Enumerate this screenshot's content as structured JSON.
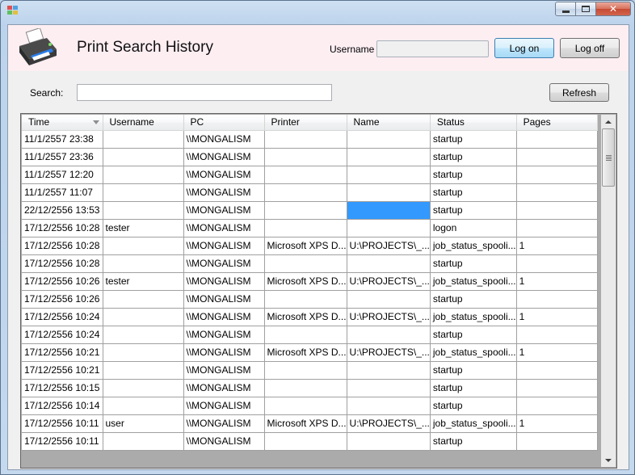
{
  "window": {
    "close_glyph": "✕",
    "minimize_icon": "minimize-icon",
    "maximize_icon": "maximize-icon"
  },
  "header": {
    "title": "Print Search History",
    "username_label": "Username",
    "username_value": "",
    "logon_label": "Log on",
    "logoff_label": "Log off"
  },
  "search": {
    "label": "Search:",
    "value": "",
    "refresh_label": "Refresh"
  },
  "colors": {
    "header_band": "#fdeef2",
    "selection": "#3399ff",
    "printer_body": "#3a3a3a",
    "printer_paper": "#2b7de9"
  },
  "grid": {
    "columns": [
      "Time",
      "Username",
      "PC",
      "Printer",
      "Name",
      "Status",
      "Pages"
    ],
    "sorted_column": "Time",
    "selected_cell": {
      "row": 4,
      "column": "Name"
    },
    "rows": [
      [
        "11/1/2557 23:38",
        "",
        "\\\\MONGALISM",
        "",
        "",
        "startup",
        ""
      ],
      [
        "11/1/2557 23:36",
        "",
        "\\\\MONGALISM",
        "",
        "",
        "startup",
        ""
      ],
      [
        "11/1/2557 12:20",
        "",
        "\\\\MONGALISM",
        "",
        "",
        "startup",
        ""
      ],
      [
        "11/1/2557 11:07",
        "",
        "\\\\MONGALISM",
        "",
        "",
        "startup",
        ""
      ],
      [
        "22/12/2556 13:53",
        "",
        "\\\\MONGALISM",
        "",
        "",
        "startup",
        ""
      ],
      [
        "17/12/2556 10:28",
        "tester",
        "\\\\MONGALISM",
        "",
        "",
        "logon",
        ""
      ],
      [
        "17/12/2556 10:28",
        "",
        "\\\\MONGALISM",
        "Microsoft XPS D...",
        "U:\\PROJECTS\\_...",
        "job_status_spooli...",
        "1"
      ],
      [
        "17/12/2556 10:28",
        "",
        "\\\\MONGALISM",
        "",
        "",
        "startup",
        ""
      ],
      [
        "17/12/2556 10:26",
        "tester",
        "\\\\MONGALISM",
        "Microsoft XPS D...",
        "U:\\PROJECTS\\_...",
        "job_status_spooli...",
        "1"
      ],
      [
        "17/12/2556 10:26",
        "",
        "\\\\MONGALISM",
        "",
        "",
        "startup",
        ""
      ],
      [
        "17/12/2556 10:24",
        "",
        "\\\\MONGALISM",
        "Microsoft XPS D...",
        "U:\\PROJECTS\\_...",
        "job_status_spooli...",
        "1"
      ],
      [
        "17/12/2556 10:24",
        "",
        "\\\\MONGALISM",
        "",
        "",
        "startup",
        ""
      ],
      [
        "17/12/2556 10:21",
        "",
        "\\\\MONGALISM",
        "Microsoft XPS D...",
        "U:\\PROJECTS\\_...",
        "job_status_spooli...",
        "1"
      ],
      [
        "17/12/2556 10:21",
        "",
        "\\\\MONGALISM",
        "",
        "",
        "startup",
        ""
      ],
      [
        "17/12/2556 10:15",
        "",
        "\\\\MONGALISM",
        "",
        "",
        "startup",
        ""
      ],
      [
        "17/12/2556 10:14",
        "",
        "\\\\MONGALISM",
        "",
        "",
        "startup",
        ""
      ],
      [
        "17/12/2556 10:11",
        "user",
        "\\\\MONGALISM",
        "Microsoft XPS D...",
        "U:\\PROJECTS\\_...",
        "job_status_spooli...",
        "1"
      ],
      [
        "17/12/2556 10:11",
        "",
        "\\\\MONGALISM",
        "",
        "",
        "startup",
        ""
      ]
    ]
  }
}
